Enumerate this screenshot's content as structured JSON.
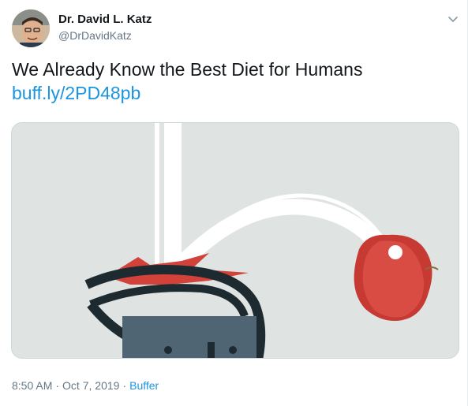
{
  "author": {
    "name": "Dr. David L. Katz",
    "handle": "@DrDavidKatz"
  },
  "tweet": {
    "text": "We Already Know the Best Diet for Humans",
    "link": "buff.ly/2PD48pb",
    "time": "8:50 AM",
    "date": "Oct 7, 2019",
    "separator": "·",
    "source": "Buffer"
  },
  "icons": {
    "menu": "chevron-down-icon"
  },
  "colors": {
    "link": "#1b95e0",
    "secondary_text": "#657786",
    "apple_red": "#d2413a",
    "image_bg": "#dfe3e1"
  }
}
